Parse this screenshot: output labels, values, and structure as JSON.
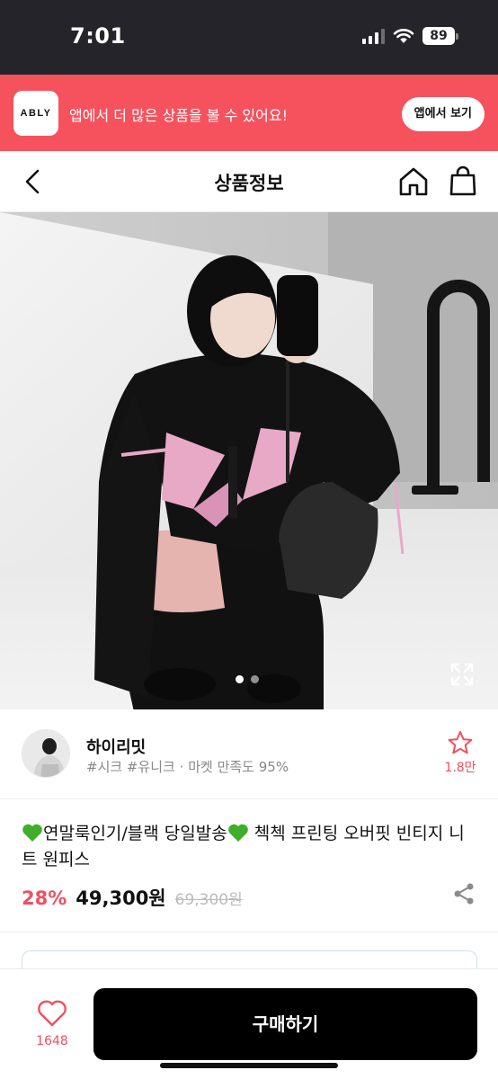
{
  "status_bar": {
    "time": "7:01",
    "battery": "89"
  },
  "app_banner": {
    "logo_text": "ABLY",
    "message": "앱에서 더 많은 상품을 볼 수 있어요!",
    "button_label": "앱에서 보기",
    "background_color": "#f5525e"
  },
  "header": {
    "title": "상품정보",
    "icons": [
      "chevron-left-icon",
      "home-icon",
      "shopping-bag-icon"
    ]
  },
  "carousel": {
    "total_slides": 2,
    "active_slide": 1,
    "expand_icon": "expand-icon"
  },
  "shop": {
    "name": "하이리밋",
    "tags": "#시크 #유니크 · 마켓 만족도 95%",
    "like_count": "1.8만",
    "like_icon": "star-icon"
  },
  "product": {
    "title_part1": "연말룩인기/블랙 당일발송",
    "title_part2": " 첵첵 프린팅 오버핏 빈티지 니트 원피스",
    "discount": "28%",
    "price": "49,300원",
    "original_price": "69,300원",
    "accent_color": "#f05060"
  },
  "bottom_bar": {
    "like_count": "1648",
    "buy_label": "구매하기"
  }
}
